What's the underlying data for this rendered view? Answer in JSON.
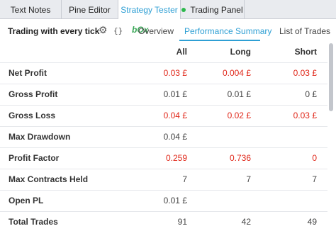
{
  "tabs": [
    {
      "label": "Text Notes"
    },
    {
      "label": "Pine Editor"
    },
    {
      "label": "Strategy Tester"
    },
    {
      "label": "Trading Panel"
    }
  ],
  "header": {
    "strategy_name": "Trading with every tick",
    "braces": "{}",
    "logo_text": "bOx",
    "subtabs": [
      {
        "label": "Overview"
      },
      {
        "label": "Performance Summary"
      },
      {
        "label": "List of Trades"
      }
    ]
  },
  "colors": {
    "accent": "#2e9fd4",
    "negative": "#e0281a",
    "live_dot": "#2db84d"
  },
  "table": {
    "columns": [
      "",
      "All",
      "Long",
      "Short"
    ],
    "rows": [
      {
        "label": "Net Profit",
        "all": "0.03 £",
        "long": "0.004 £",
        "short": "0.03 £"
      },
      {
        "label": "Gross Profit",
        "all": "0.01 £",
        "long": "0.01 £",
        "short": "0 £"
      },
      {
        "label": "Gross Loss",
        "all": "0.04 £",
        "long": "0.02 £",
        "short": "0.03 £"
      },
      {
        "label": "Max Drawdown",
        "all": "0.04 £",
        "long": "",
        "short": ""
      },
      {
        "label": "Profit Factor",
        "all": "0.259",
        "long": "0.736",
        "short": "0"
      },
      {
        "label": "Max Contracts Held",
        "all": "7",
        "long": "7",
        "short": "7"
      },
      {
        "label": "Open PL",
        "all": "0.01 £",
        "long": "",
        "short": ""
      },
      {
        "label": "Total Trades",
        "all": "91",
        "long": "42",
        "short": "49"
      }
    ]
  }
}
